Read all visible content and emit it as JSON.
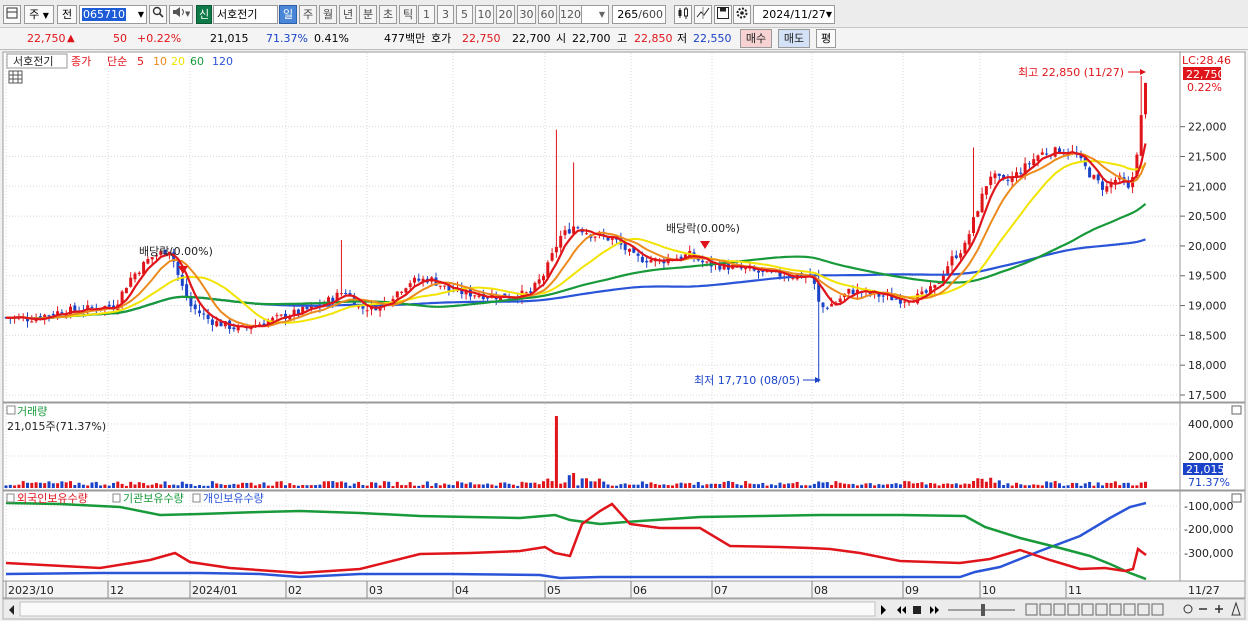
{
  "toolbar": {
    "unit": "주",
    "prev_label": "전",
    "stock_code": "065710",
    "stock_name": "서호전기",
    "credit_badge": "신",
    "periods": [
      "일",
      "주",
      "월",
      "년",
      "분",
      "초",
      "틱"
    ],
    "active_period": "일",
    "intervals": [
      "1",
      "3",
      "5",
      "10",
      "20",
      "30",
      "60",
      "120"
    ],
    "count": "265",
    "count_total": "/600",
    "date": "2024/11/27"
  },
  "quote": {
    "price": "22,750",
    "change_arrow": "▲",
    "change": "50",
    "change_pct": "+0.22%",
    "volume": "21,015",
    "volume_ratio": "71.37%",
    "turnover": "0.41%",
    "trade_value": "477백만",
    "bid_label": "호가",
    "bid": "22,750",
    "ask": "22,700",
    "open_label": "시",
    "open": "22,700",
    "high_label": "고",
    "high": "22,850",
    "low_label": "저",
    "low": "22,550",
    "buy_label": "매수",
    "sell_label": "매도",
    "avg_label": "평"
  },
  "price_panel": {
    "stock_tag": "서호전기",
    "legend_close": "종가",
    "legend_ma": "단순",
    "ma_periods": [
      "5",
      "10",
      "20",
      "60",
      "120"
    ],
    "ma_colors": [
      "#e0151b",
      "#ec8a1c",
      "#f2e400",
      "#189a3a",
      "#2a55d8"
    ],
    "lc_label": "LC:28.46",
    "current_price_tag": "22,750",
    "current_pct": "0.22%",
    "high_annotation": "최고 22,850 (11/27)",
    "low_annotation": "최저 17,710 (08/05)",
    "dividend_annotation": "배당락(0.00%)",
    "dividend_annotation_2": "배당락(0.00%)",
    "y_ticks": [
      "22,000",
      "21,500",
      "21,000",
      "20,500",
      "20,000",
      "19,500",
      "19,000",
      "18,500",
      "18,000",
      "17,500"
    ]
  },
  "volume_panel": {
    "title": "거래량",
    "value_label": "21,015주(71.37%)",
    "y_ticks": [
      "400,000",
      "200,000"
    ],
    "current_tag": "21,015",
    "current_pct": "71.37%"
  },
  "holding_panel": {
    "series_labels": [
      "외국인보유수량",
      "기관보유수량",
      "개인보유수량"
    ],
    "series_colors": [
      "#e0151b",
      "#189a3a",
      "#2a55d8"
    ],
    "y_ticks": [
      "-100,000",
      "-200,000",
      "-300,000"
    ]
  },
  "x_axis": {
    "labels": [
      "2023/10",
      "12",
      "2024/01",
      "02",
      "03",
      "04",
      "05",
      "06",
      "07",
      "08",
      "09",
      "10",
      "11"
    ],
    "right_label": "11/27"
  },
  "colors": {
    "up": "#e0151b",
    "down": "#1a43c8",
    "grid": "#d8d8d8"
  },
  "chart_data": {
    "type": "line",
    "title": "",
    "xlabel": "",
    "ylabel": "",
    "x": [
      "2023/10",
      "12",
      "2024/01",
      "02",
      "03",
      "04",
      "05",
      "06",
      "07",
      "08",
      "09",
      "10",
      "11",
      "11/27"
    ],
    "ylim": [
      17500,
      22850
    ],
    "series": [
      {
        "name": "종가",
        "values": [
          18800,
          18900,
          19800,
          18600,
          18900,
          19300,
          19100,
          20200,
          19700,
          19500,
          19200,
          21200,
          21300,
          22750
        ]
      },
      {
        "name": "120",
        "values": [
          18750,
          18850,
          18950,
          19050,
          19100,
          19150,
          19200,
          19350,
          19450,
          19550,
          19600,
          19800,
          20000,
          20150
        ]
      }
    ]
  }
}
